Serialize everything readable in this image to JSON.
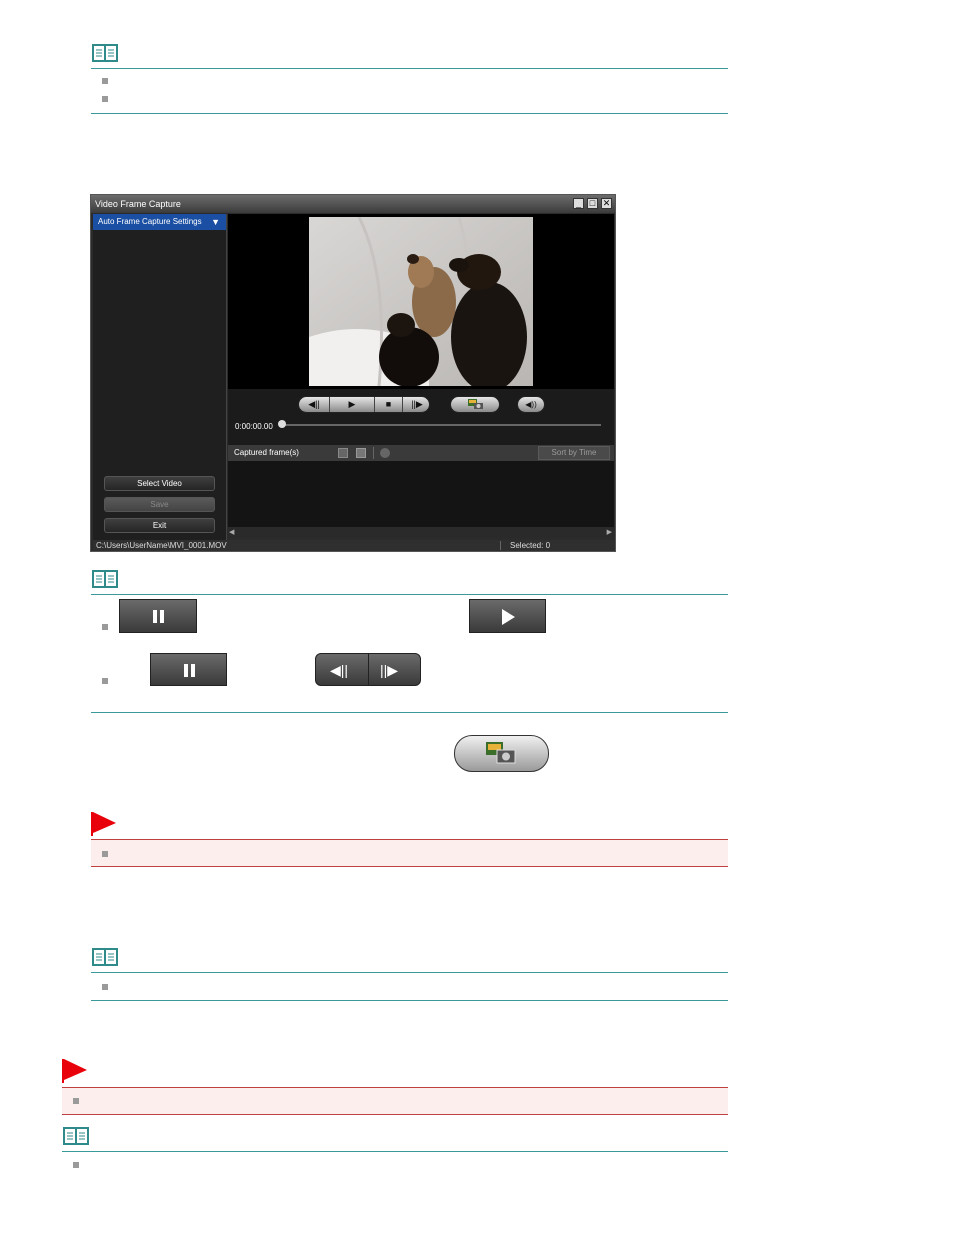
{
  "window": {
    "title": "Video Frame Capture",
    "settings_label": "Auto Frame Capture Settings",
    "select_video_label": "Select Video",
    "save_label": "Save",
    "exit_label": "Exit",
    "timecode": "0:00:00.00",
    "captured_label": "Captured frame(s)",
    "sort_label": "Sort by Time",
    "status_path": "C:\\Users\\UserName\\MVI_0001.MOV",
    "status_selected": "Selected: 0"
  },
  "colors": {
    "note_rule": "#3a9a9a",
    "important_rule": "#c04040",
    "important_bg": "#fdeeee",
    "flag": "#e8000b",
    "settings_bar": "#1a4fa3"
  }
}
